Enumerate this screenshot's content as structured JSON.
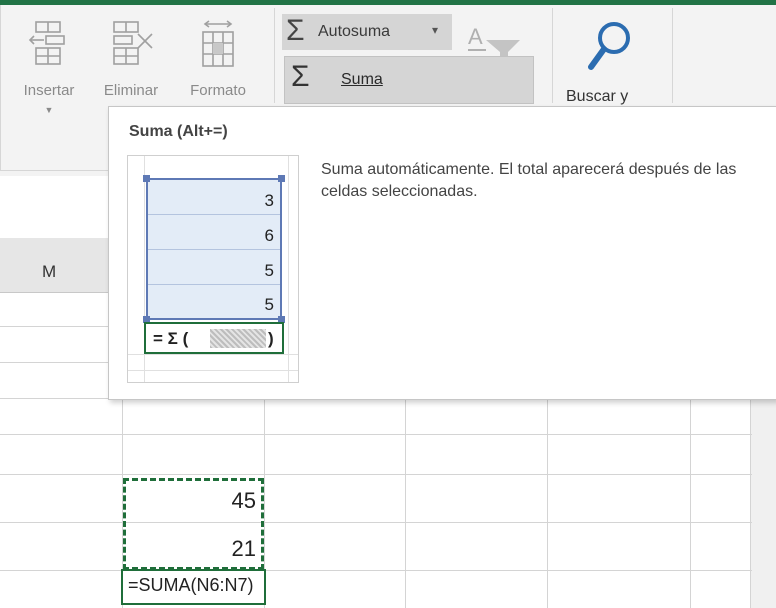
{
  "ribbon": {
    "insert_label": "Insertar",
    "delete_label": "Eliminar",
    "format_label": "Formato",
    "autosum_label": "Autosuma",
    "autosum_arrow": "▾",
    "sum_menu_item": "Suma",
    "find_label": "Buscar y"
  },
  "tooltip": {
    "title": "Suma (Alt+=)",
    "description": "Suma automáticamente. El total aparecerá después de las celdas seleccionadas.",
    "preview_values": [
      "3",
      "6",
      "5",
      "5"
    ],
    "preview_formula_prefix": "= Σ (",
    "preview_formula_suffix": ")"
  },
  "sheet": {
    "column_M": "M",
    "cell_1": "45",
    "cell_2": "21",
    "formula_cell": "=SUMA(N6:N7)"
  },
  "colors": {
    "accent": "#217346",
    "selection_border": "#5e79b5",
    "selection_fill": "#e3ecf7",
    "menu_highlight": "#d5d5d5"
  },
  "icons": [
    "insert-cells-icon",
    "delete-cells-icon",
    "format-cells-icon",
    "sigma-icon",
    "dropdown-arrow-icon",
    "clear-icon",
    "search-icon",
    "marquee-border"
  ]
}
